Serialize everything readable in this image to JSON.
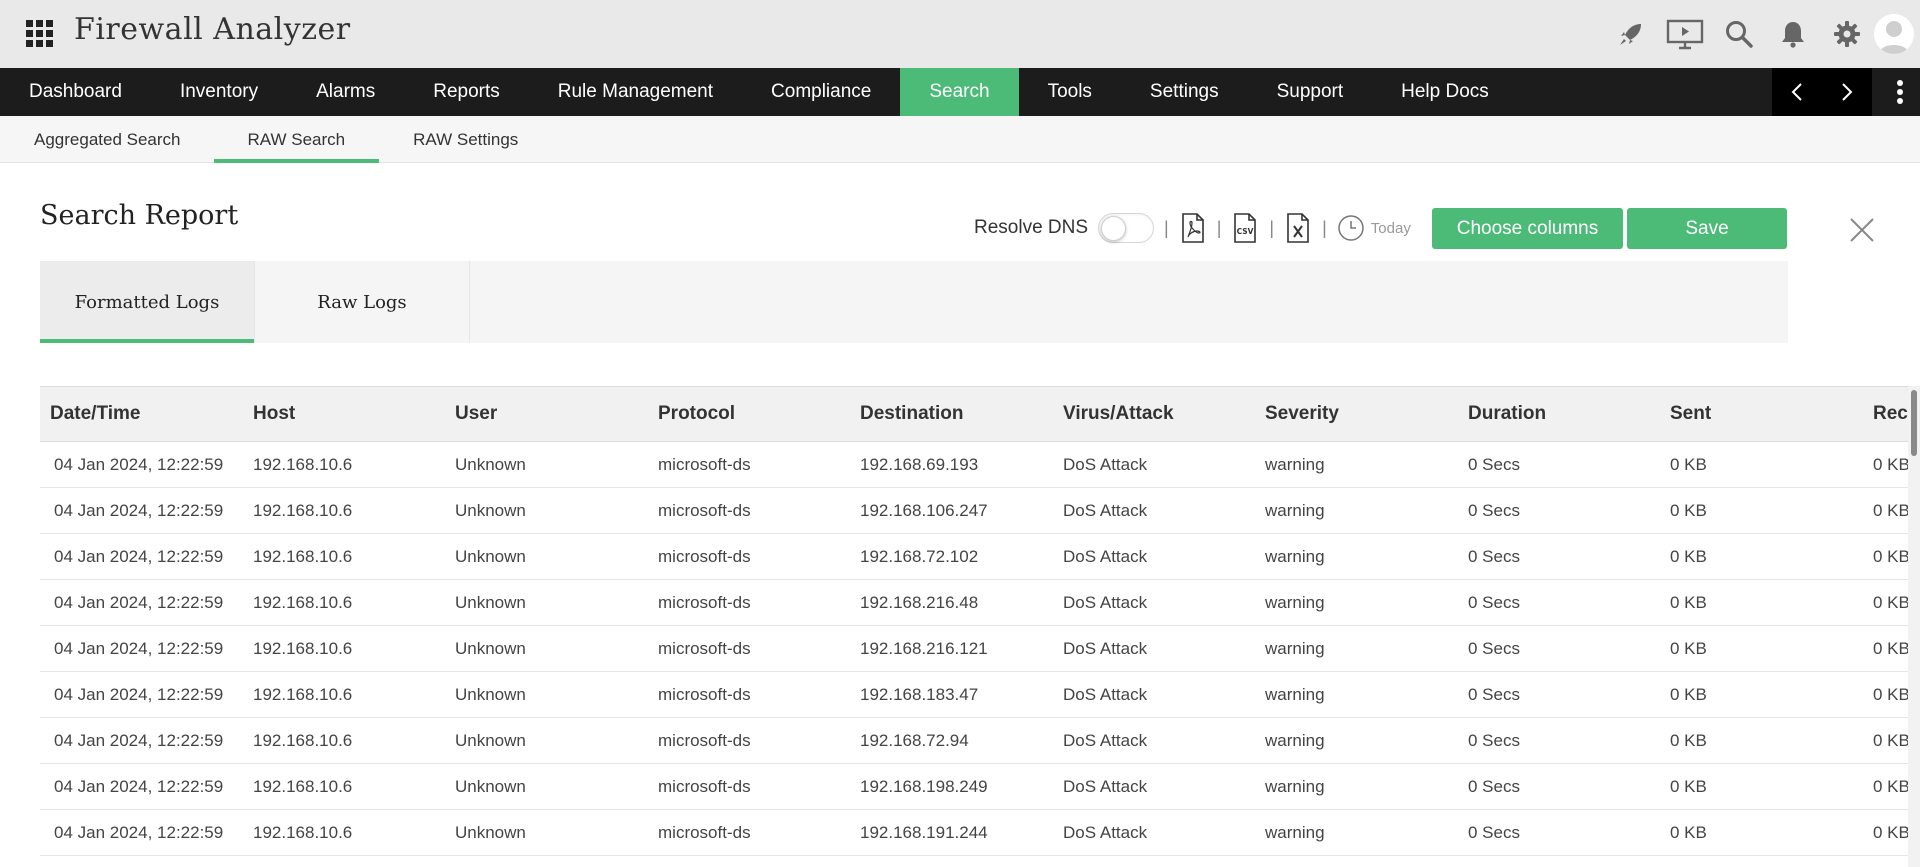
{
  "app": {
    "title": "Firewall Analyzer"
  },
  "header_icons": [
    "rocket-icon",
    "presentation-icon",
    "search-icon",
    "bell-icon",
    "gear-icon",
    "user-avatar-icon"
  ],
  "nav": {
    "items": [
      {
        "label": "Dashboard"
      },
      {
        "label": "Inventory"
      },
      {
        "label": "Alarms"
      },
      {
        "label": "Reports"
      },
      {
        "label": "Rule Management"
      },
      {
        "label": "Compliance"
      },
      {
        "label": "Search",
        "active": true
      },
      {
        "label": "Tools"
      },
      {
        "label": "Settings"
      },
      {
        "label": "Support"
      },
      {
        "label": "Help Docs"
      }
    ]
  },
  "subnav": {
    "items": [
      {
        "label": "Aggregated Search"
      },
      {
        "label": "RAW Search",
        "active": true
      },
      {
        "label": "RAW Settings"
      }
    ]
  },
  "report": {
    "title": "Search Report",
    "resolve_dns_label": "Resolve DNS",
    "resolve_dns_on": false,
    "period_label": "Today",
    "choose_columns_label": "Choose columns",
    "save_label": "Save",
    "export_icons": [
      "pdf-export-icon",
      "csv-export-icon",
      "excel-export-icon"
    ]
  },
  "log_tabs": [
    {
      "label": "Formatted Logs",
      "active": true
    },
    {
      "label": "Raw Logs"
    }
  ],
  "table": {
    "columns": [
      "Date/Time",
      "Host",
      "User",
      "Protocol",
      "Destination",
      "Virus/Attack",
      "Severity",
      "Duration",
      "Sent",
      "Rec"
    ],
    "rows": [
      [
        "04 Jan 2024, 12:22:59",
        "192.168.10.6",
        "Unknown",
        "microsoft-ds",
        "192.168.69.193",
        "DoS Attack",
        "warning",
        "0 Secs",
        "0 KB",
        "0 KB"
      ],
      [
        "04 Jan 2024, 12:22:59",
        "192.168.10.6",
        "Unknown",
        "microsoft-ds",
        "192.168.106.247",
        "DoS Attack",
        "warning",
        "0 Secs",
        "0 KB",
        "0 KB"
      ],
      [
        "04 Jan 2024, 12:22:59",
        "192.168.10.6",
        "Unknown",
        "microsoft-ds",
        "192.168.72.102",
        "DoS Attack",
        "warning",
        "0 Secs",
        "0 KB",
        "0 KB"
      ],
      [
        "04 Jan 2024, 12:22:59",
        "192.168.10.6",
        "Unknown",
        "microsoft-ds",
        "192.168.216.48",
        "DoS Attack",
        "warning",
        "0 Secs",
        "0 KB",
        "0 KB"
      ],
      [
        "04 Jan 2024, 12:22:59",
        "192.168.10.6",
        "Unknown",
        "microsoft-ds",
        "192.168.216.121",
        "DoS Attack",
        "warning",
        "0 Secs",
        "0 KB",
        "0 KB"
      ],
      [
        "04 Jan 2024, 12:22:59",
        "192.168.10.6",
        "Unknown",
        "microsoft-ds",
        "192.168.183.47",
        "DoS Attack",
        "warning",
        "0 Secs",
        "0 KB",
        "0 KB"
      ],
      [
        "04 Jan 2024, 12:22:59",
        "192.168.10.6",
        "Unknown",
        "microsoft-ds",
        "192.168.72.94",
        "DoS Attack",
        "warning",
        "0 Secs",
        "0 KB",
        "0 KB"
      ],
      [
        "04 Jan 2024, 12:22:59",
        "192.168.10.6",
        "Unknown",
        "microsoft-ds",
        "192.168.198.249",
        "DoS Attack",
        "warning",
        "0 Secs",
        "0 KB",
        "0 KB"
      ],
      [
        "04 Jan 2024, 12:22:59",
        "192.168.10.6",
        "Unknown",
        "microsoft-ds",
        "192.168.191.244",
        "DoS Attack",
        "warning",
        "0 Secs",
        "0 KB",
        "0 KB"
      ]
    ]
  },
  "colors": {
    "accent": "#4cbb78",
    "nav_bg": "#1c1c1c",
    "header_bg": "#e9e9e9"
  }
}
